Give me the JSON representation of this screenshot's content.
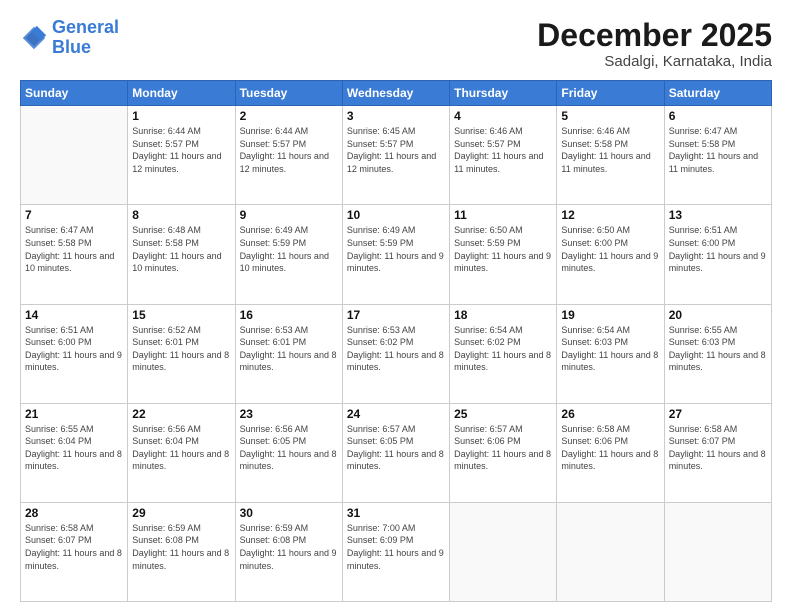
{
  "header": {
    "logo_line1": "General",
    "logo_line2": "Blue",
    "month": "December 2025",
    "location": "Sadalgi, Karnataka, India"
  },
  "days_of_week": [
    "Sunday",
    "Monday",
    "Tuesday",
    "Wednesday",
    "Thursday",
    "Friday",
    "Saturday"
  ],
  "weeks": [
    [
      {
        "day": "",
        "info": ""
      },
      {
        "day": "1",
        "info": "Sunrise: 6:44 AM\nSunset: 5:57 PM\nDaylight: 11 hours\nand 12 minutes."
      },
      {
        "day": "2",
        "info": "Sunrise: 6:44 AM\nSunset: 5:57 PM\nDaylight: 11 hours\nand 12 minutes."
      },
      {
        "day": "3",
        "info": "Sunrise: 6:45 AM\nSunset: 5:57 PM\nDaylight: 11 hours\nand 12 minutes."
      },
      {
        "day": "4",
        "info": "Sunrise: 6:46 AM\nSunset: 5:57 PM\nDaylight: 11 hours\nand 11 minutes."
      },
      {
        "day": "5",
        "info": "Sunrise: 6:46 AM\nSunset: 5:58 PM\nDaylight: 11 hours\nand 11 minutes."
      },
      {
        "day": "6",
        "info": "Sunrise: 6:47 AM\nSunset: 5:58 PM\nDaylight: 11 hours\nand 11 minutes."
      }
    ],
    [
      {
        "day": "7",
        "info": "Sunrise: 6:47 AM\nSunset: 5:58 PM\nDaylight: 11 hours\nand 10 minutes."
      },
      {
        "day": "8",
        "info": "Sunrise: 6:48 AM\nSunset: 5:58 PM\nDaylight: 11 hours\nand 10 minutes."
      },
      {
        "day": "9",
        "info": "Sunrise: 6:49 AM\nSunset: 5:59 PM\nDaylight: 11 hours\nand 10 minutes."
      },
      {
        "day": "10",
        "info": "Sunrise: 6:49 AM\nSunset: 5:59 PM\nDaylight: 11 hours\nand 9 minutes."
      },
      {
        "day": "11",
        "info": "Sunrise: 6:50 AM\nSunset: 5:59 PM\nDaylight: 11 hours\nand 9 minutes."
      },
      {
        "day": "12",
        "info": "Sunrise: 6:50 AM\nSunset: 6:00 PM\nDaylight: 11 hours\nand 9 minutes."
      },
      {
        "day": "13",
        "info": "Sunrise: 6:51 AM\nSunset: 6:00 PM\nDaylight: 11 hours\nand 9 minutes."
      }
    ],
    [
      {
        "day": "14",
        "info": "Sunrise: 6:51 AM\nSunset: 6:00 PM\nDaylight: 11 hours\nand 9 minutes."
      },
      {
        "day": "15",
        "info": "Sunrise: 6:52 AM\nSunset: 6:01 PM\nDaylight: 11 hours\nand 8 minutes."
      },
      {
        "day": "16",
        "info": "Sunrise: 6:53 AM\nSunset: 6:01 PM\nDaylight: 11 hours\nand 8 minutes."
      },
      {
        "day": "17",
        "info": "Sunrise: 6:53 AM\nSunset: 6:02 PM\nDaylight: 11 hours\nand 8 minutes."
      },
      {
        "day": "18",
        "info": "Sunrise: 6:54 AM\nSunset: 6:02 PM\nDaylight: 11 hours\nand 8 minutes."
      },
      {
        "day": "19",
        "info": "Sunrise: 6:54 AM\nSunset: 6:03 PM\nDaylight: 11 hours\nand 8 minutes."
      },
      {
        "day": "20",
        "info": "Sunrise: 6:55 AM\nSunset: 6:03 PM\nDaylight: 11 hours\nand 8 minutes."
      }
    ],
    [
      {
        "day": "21",
        "info": "Sunrise: 6:55 AM\nSunset: 6:04 PM\nDaylight: 11 hours\nand 8 minutes."
      },
      {
        "day": "22",
        "info": "Sunrise: 6:56 AM\nSunset: 6:04 PM\nDaylight: 11 hours\nand 8 minutes."
      },
      {
        "day": "23",
        "info": "Sunrise: 6:56 AM\nSunset: 6:05 PM\nDaylight: 11 hours\nand 8 minutes."
      },
      {
        "day": "24",
        "info": "Sunrise: 6:57 AM\nSunset: 6:05 PM\nDaylight: 11 hours\nand 8 minutes."
      },
      {
        "day": "25",
        "info": "Sunrise: 6:57 AM\nSunset: 6:06 PM\nDaylight: 11 hours\nand 8 minutes."
      },
      {
        "day": "26",
        "info": "Sunrise: 6:58 AM\nSunset: 6:06 PM\nDaylight: 11 hours\nand 8 minutes."
      },
      {
        "day": "27",
        "info": "Sunrise: 6:58 AM\nSunset: 6:07 PM\nDaylight: 11 hours\nand 8 minutes."
      }
    ],
    [
      {
        "day": "28",
        "info": "Sunrise: 6:58 AM\nSunset: 6:07 PM\nDaylight: 11 hours\nand 8 minutes."
      },
      {
        "day": "29",
        "info": "Sunrise: 6:59 AM\nSunset: 6:08 PM\nDaylight: 11 hours\nand 8 minutes."
      },
      {
        "day": "30",
        "info": "Sunrise: 6:59 AM\nSunset: 6:08 PM\nDaylight: 11 hours\nand 9 minutes."
      },
      {
        "day": "31",
        "info": "Sunrise: 7:00 AM\nSunset: 6:09 PM\nDaylight: 11 hours\nand 9 minutes."
      },
      {
        "day": "",
        "info": ""
      },
      {
        "day": "",
        "info": ""
      },
      {
        "day": "",
        "info": ""
      }
    ]
  ]
}
